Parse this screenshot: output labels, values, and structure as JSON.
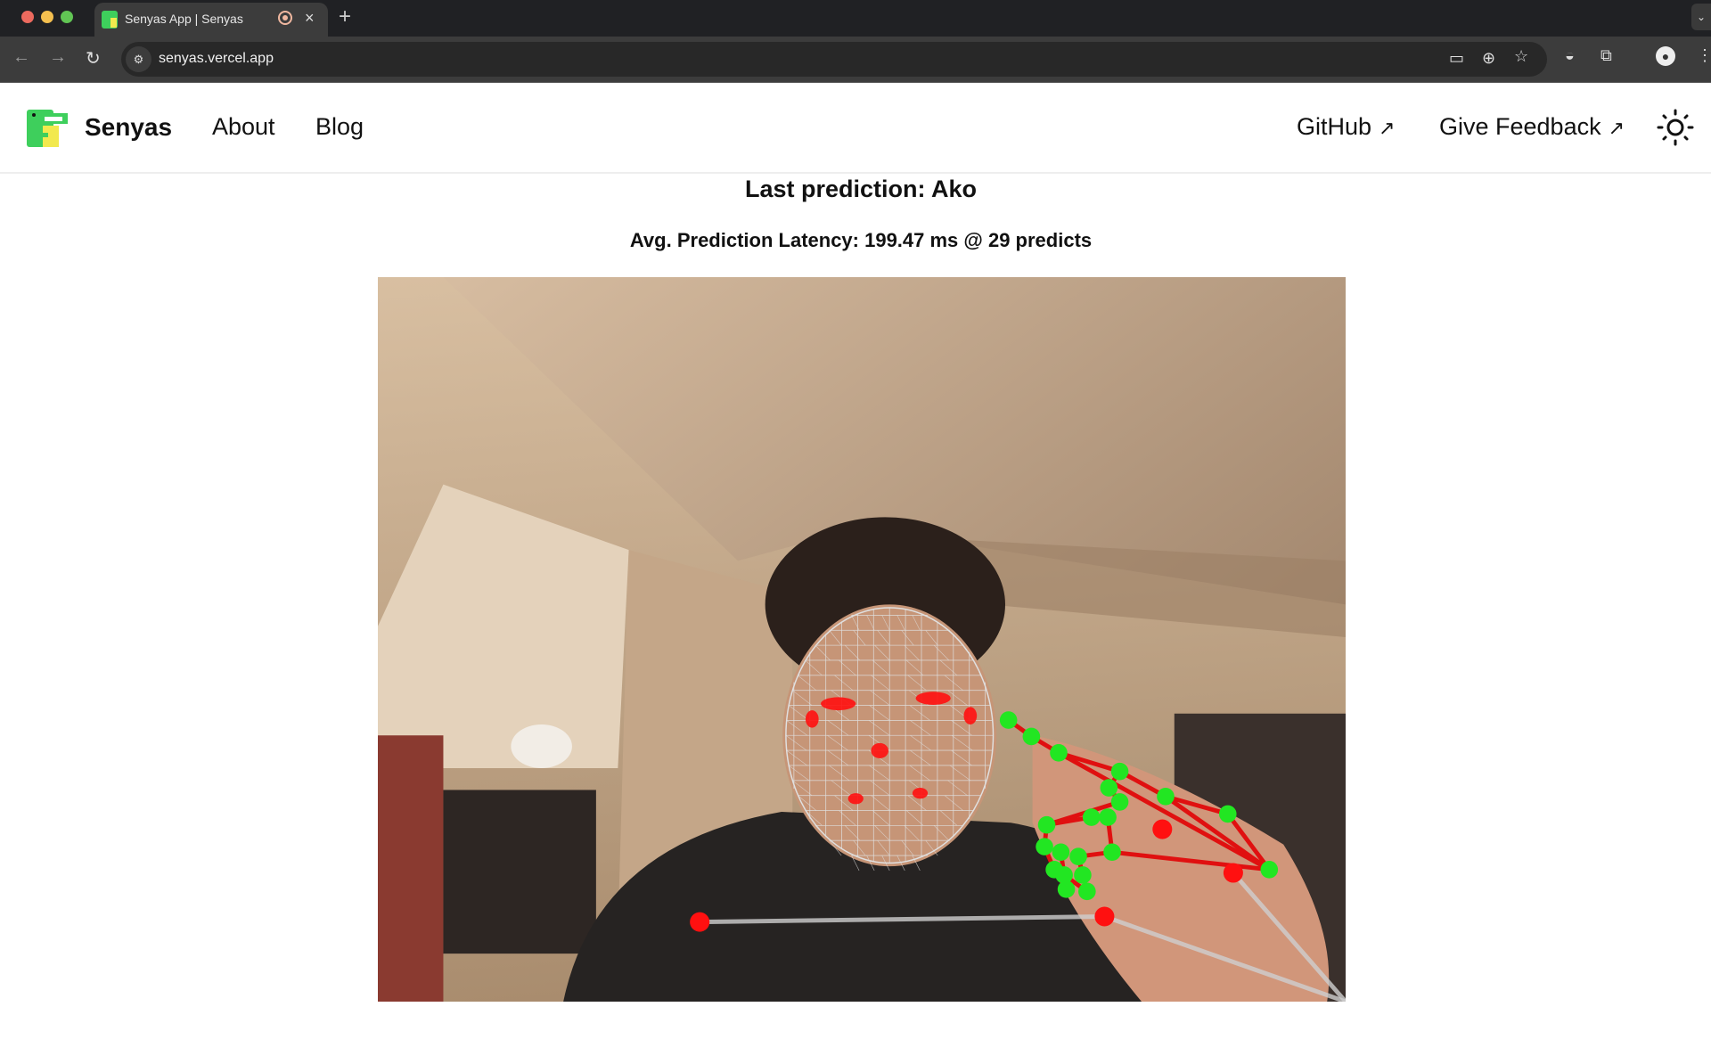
{
  "browser": {
    "tab_title": "Senyas App | Senyas",
    "url": "senyas.vercel.app",
    "new_tab": "+",
    "close_tab": "×"
  },
  "header": {
    "brand": "Senyas",
    "nav": [
      {
        "label": "About"
      },
      {
        "label": "Blog"
      }
    ],
    "right_links": [
      {
        "label": "GitHub",
        "icon": "external-link-icon"
      },
      {
        "label": "Give Feedback",
        "icon": "external-link-icon"
      }
    ],
    "theme_toggle_icon": "sun-icon"
  },
  "main": {
    "last_prediction": "Last prediction: Ako",
    "latency": "Avg. Prediction Latency: 199.47 ms @ 29 predicts"
  },
  "colors": {
    "landmark_green": "#22e622",
    "landmark_red": "#ff1010",
    "mesh": "#e0e0e0"
  }
}
